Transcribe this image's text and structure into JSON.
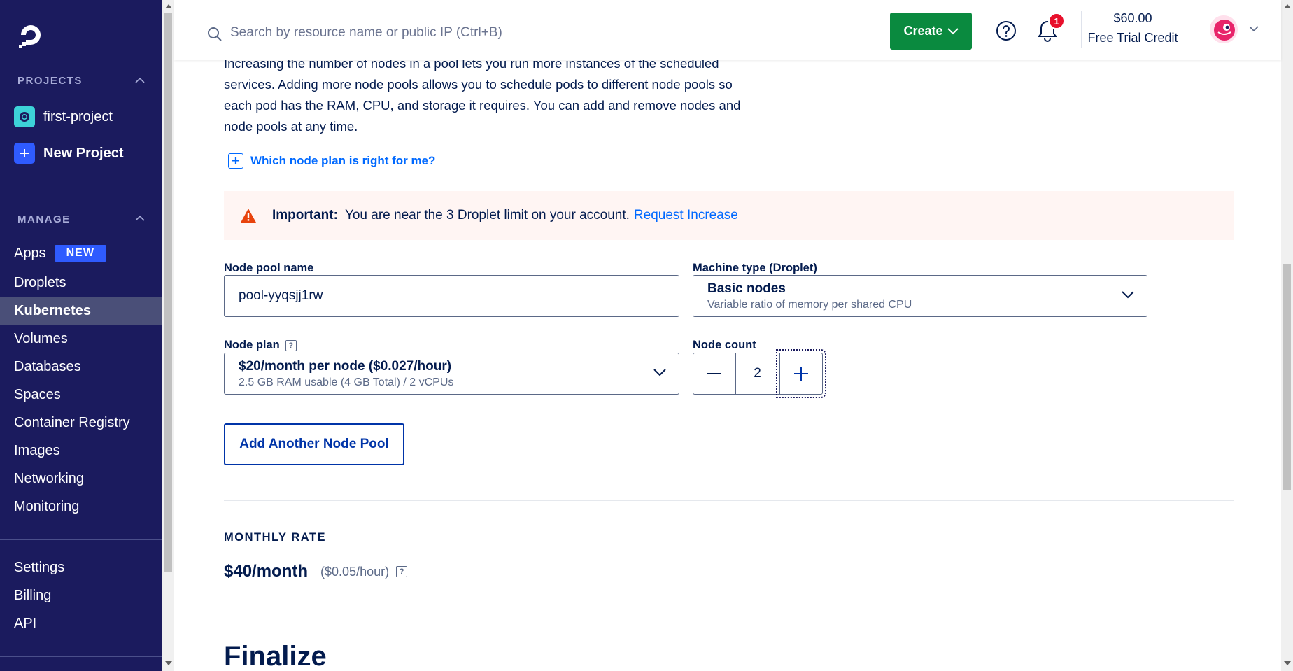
{
  "sidebar": {
    "projects_heading": "PROJECTS",
    "projects": [
      {
        "label": "first-project"
      },
      {
        "label": "New Project"
      }
    ],
    "manage_heading": "MANAGE",
    "manage_items": [
      {
        "label": "Apps",
        "badge": "NEW"
      },
      {
        "label": "Droplets"
      },
      {
        "label": "Kubernetes",
        "active": true
      },
      {
        "label": "Volumes"
      },
      {
        "label": "Databases"
      },
      {
        "label": "Spaces"
      },
      {
        "label": "Container Registry"
      },
      {
        "label": "Images"
      },
      {
        "label": "Networking"
      },
      {
        "label": "Monitoring"
      }
    ],
    "account_items": [
      {
        "label": "Settings"
      },
      {
        "label": "Billing"
      },
      {
        "label": "API"
      }
    ]
  },
  "header": {
    "search_placeholder": "Search by resource name or public IP (Ctrl+B)",
    "create_label": "Create",
    "notification_count": "1",
    "credit_amount": "$60.00",
    "credit_label": "Free Trial Credit"
  },
  "main": {
    "intro_text": "Increasing the number of nodes in a pool lets you run more instances of the scheduled services. Adding more node pools allows you to schedule pods to different node pools so each pod has the RAM, CPU, and storage it requires. You can add and remove nodes and node pools at any time.",
    "which_plan_link": "Which node plan is right for me?",
    "alert": {
      "title": "Important:",
      "message": "You are near the 3 Droplet limit on your account.",
      "link": "Request Increase"
    },
    "node_pool_name_label": "Node pool name",
    "node_pool_name_value": "pool-yyqsjj1rw",
    "machine_type_label": "Machine type (Droplet)",
    "machine_type_title": "Basic nodes",
    "machine_type_sub": "Variable ratio of memory per shared CPU",
    "node_plan_label": "Node plan",
    "node_plan_title": "$20/month per node ($0.027/hour)",
    "node_plan_sub": "2.5 GB RAM usable (4 GB Total) / 2 vCPUs",
    "node_count_label": "Node count",
    "node_count_value": "2",
    "add_pool_label": "Add Another Node Pool",
    "monthly_rate_heading": "MONTHLY RATE",
    "monthly_rate_value": "$40/month",
    "hourly_rate_value": "($0.05/hour)",
    "finalize_heading": "Finalize"
  },
  "colors": {
    "sidebar_bg": "#1b1b5e",
    "create_green": "#0a8a3f",
    "link_blue": "#0069ff",
    "alert_bg": "#fff5f3",
    "warning_orange": "#e8430c"
  }
}
